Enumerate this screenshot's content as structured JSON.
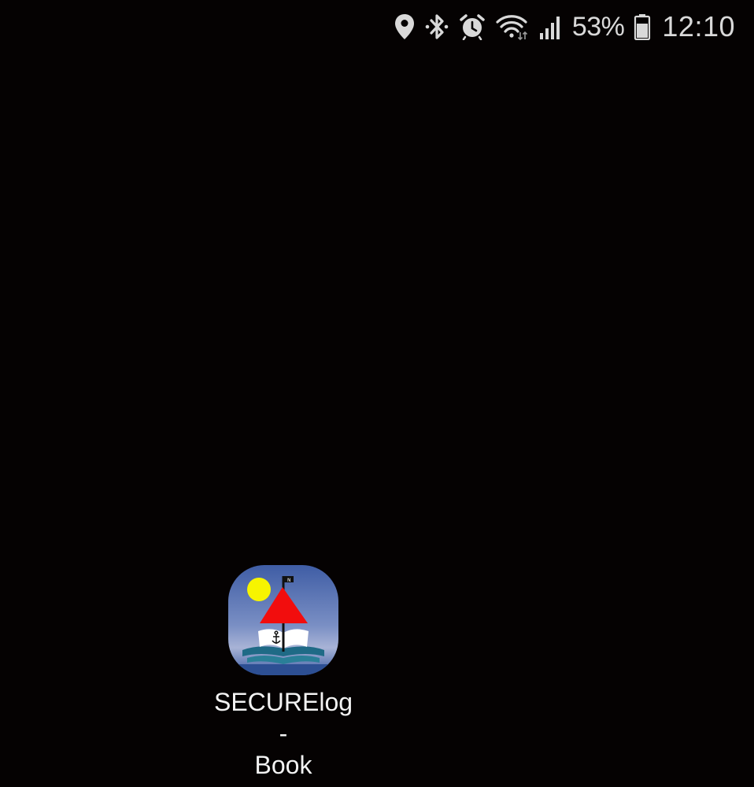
{
  "status_bar": {
    "icons": [
      "location-icon",
      "bluetooth-icon",
      "alarm-icon",
      "wifi-icon",
      "signal-icon",
      "battery-icon"
    ],
    "battery_percent": "53%",
    "time": "12:10",
    "text_color": "#d9d9d9"
  },
  "home_screen": {
    "background_color": "#050202",
    "apps": [
      {
        "label_line1": "SECURElog-",
        "label_line2": "Book",
        "icon": "sailboat-book-icon"
      }
    ]
  }
}
